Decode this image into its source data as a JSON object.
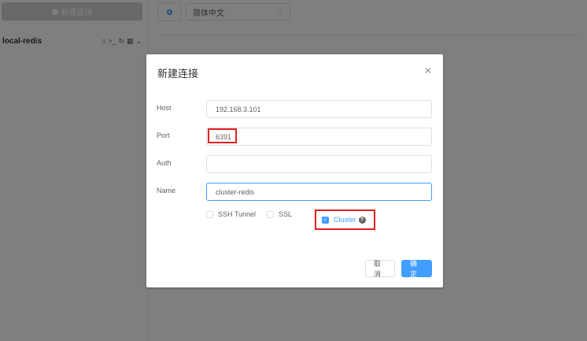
{
  "sidebar": {
    "new_connection_label": "新建连接",
    "connection_name": "local-redis",
    "connection_icons": [
      "home-icon",
      "terminal-icon",
      "refresh-icon",
      "grid-icon",
      "chevron-down-icon"
    ]
  },
  "topbar": {
    "language_value": "简体中文"
  },
  "dialog": {
    "title": "新建连接",
    "fields": {
      "host": {
        "label": "Host",
        "value": "192.168.3.101"
      },
      "port": {
        "label": "Port",
        "value": "6391"
      },
      "auth": {
        "label": "Auth",
        "value": ""
      },
      "name": {
        "label": "Name",
        "value": "cluster-redis"
      }
    },
    "checkboxes": {
      "ssh": {
        "label": "SSH Tunnel",
        "checked": false
      },
      "ssl": {
        "label": "SSL",
        "checked": false
      },
      "cluster": {
        "label": "Cluster",
        "checked": true
      }
    },
    "cancel_label": "取消",
    "ok_label": "确定"
  },
  "colors": {
    "accent": "#409eff",
    "highlight": "#e02020",
    "overlay": "rgba(0,0,0,0.5)"
  }
}
